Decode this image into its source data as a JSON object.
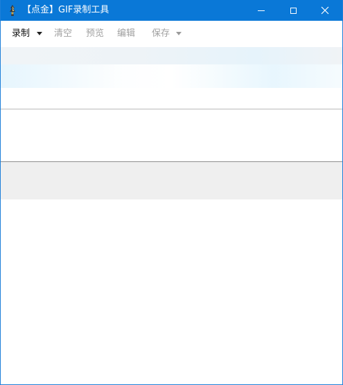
{
  "window": {
    "title": "【点金】GIF录制工具"
  },
  "menu": {
    "items": [
      {
        "label": "录制",
        "enabled": true,
        "has_dropdown": true
      },
      {
        "label": "清空",
        "enabled": false,
        "has_dropdown": false
      },
      {
        "label": "预览",
        "enabled": false,
        "has_dropdown": false
      },
      {
        "label": "编辑",
        "enabled": false,
        "has_dropdown": false
      },
      {
        "label": "保存",
        "enabled": false,
        "has_dropdown": true
      }
    ]
  },
  "icons": {
    "app": "app-logo-icon",
    "minimize": "minimize-icon",
    "maximize": "maximize-icon",
    "close": "close-icon",
    "record_dropdown": "caret-down-icon",
    "save_dropdown": "caret-down-icon"
  },
  "colors": {
    "titlebar": "#0a78d7",
    "menu_enabled_text": "#111111",
    "menu_disabled_text": "#a0a0a0"
  }
}
